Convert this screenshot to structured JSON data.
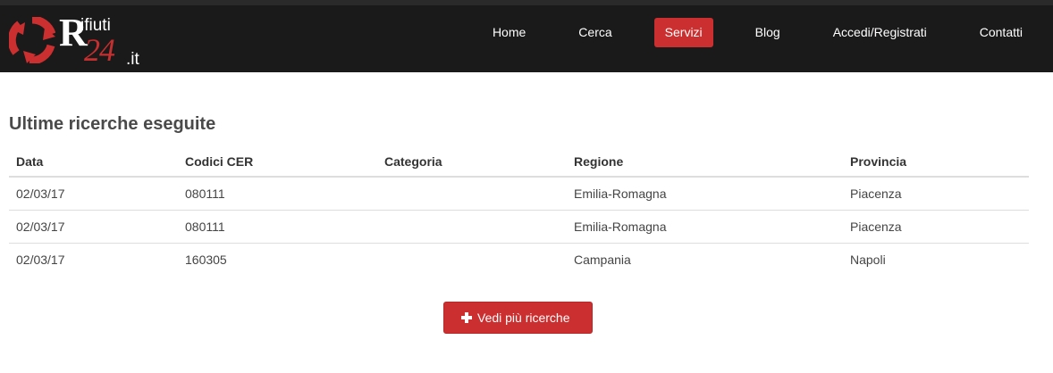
{
  "brand": {
    "initial": "R",
    "word": "ifiuti",
    "number": "24",
    "tld": ".it",
    "accent_color": "#cc2f2f"
  },
  "nav": {
    "items": [
      {
        "label": "Home",
        "active": false
      },
      {
        "label": "Cerca",
        "active": false
      },
      {
        "label": "Servizi",
        "active": true
      },
      {
        "label": "Blog",
        "active": false
      },
      {
        "label": "Accedi/Registrati",
        "active": false
      },
      {
        "label": "Contatti",
        "active": false
      }
    ]
  },
  "main": {
    "title": "Ultime ricerche eseguite",
    "table": {
      "headers": [
        "Data",
        "Codici CER",
        "Categoria",
        "Regione",
        "Provincia"
      ],
      "rows": [
        [
          "02/03/17",
          "080111",
          "",
          "Emilia-Romagna",
          "Piacenza"
        ],
        [
          "02/03/17",
          "080111",
          "",
          "Emilia-Romagna",
          "Piacenza"
        ],
        [
          "02/03/17",
          "160305",
          "",
          "Campania",
          "Napoli"
        ]
      ]
    },
    "more_button": {
      "icon": "plus-icon",
      "label": "Vedi più ricerche"
    }
  }
}
